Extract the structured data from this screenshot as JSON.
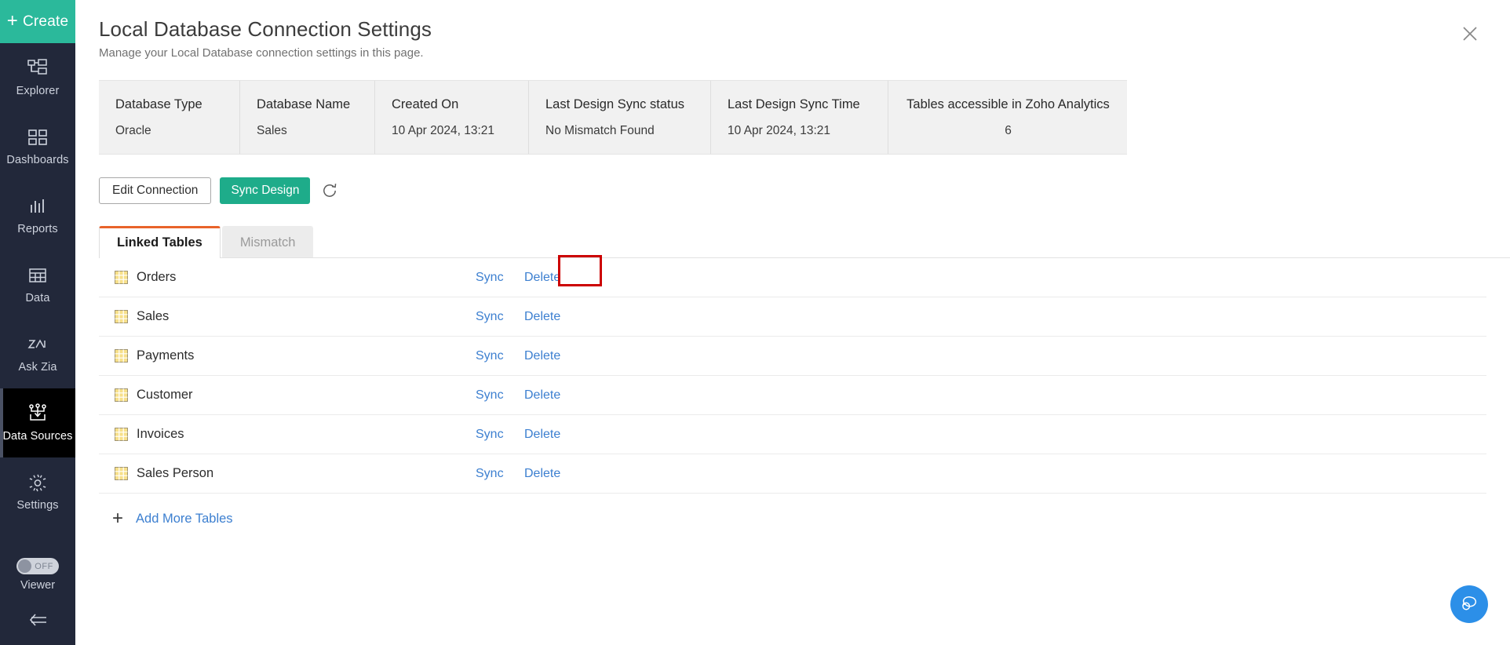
{
  "sidebar": {
    "create_label": "Create",
    "items": [
      {
        "label": "Explorer",
        "icon": "explorer-icon",
        "active": false
      },
      {
        "label": "Dashboards",
        "icon": "dashboards-icon",
        "active": false
      },
      {
        "label": "Reports",
        "icon": "reports-icon",
        "active": false
      },
      {
        "label": "Data",
        "icon": "data-icon",
        "active": false
      },
      {
        "label": "Ask Zia",
        "icon": "ask-zia-icon",
        "active": false
      },
      {
        "label": "Data Sources",
        "icon": "data-sources-icon",
        "active": true
      },
      {
        "label": "Settings",
        "icon": "settings-gear-icon",
        "active": false
      }
    ],
    "viewer": {
      "label": "Viewer",
      "toggle_state": "OFF"
    },
    "collapse_label": "collapse-sidebar"
  },
  "header": {
    "title": "Local Database Connection Settings",
    "subtitle": "Manage your Local Database connection settings in this page.",
    "close_label": "close-icon"
  },
  "info_table": {
    "columns": [
      {
        "header": "Database Type",
        "value": "Oracle"
      },
      {
        "header": "Database Name",
        "value": "Sales"
      },
      {
        "header": "Created On",
        "value": "10 Apr 2024, 13:21"
      },
      {
        "header": "Last Design Sync status",
        "value": "No Mismatch Found"
      },
      {
        "header": "Last Design Sync Time",
        "value": "10 Apr 2024, 13:21"
      },
      {
        "header": "Tables accessible in Zoho Analytics",
        "value": "6"
      }
    ]
  },
  "actions": {
    "edit_connection_label": "Edit Connection",
    "sync_design_label": "Sync Design",
    "refresh_label": "refresh-icon"
  },
  "tabs": [
    {
      "label": "Linked Tables",
      "active": true
    },
    {
      "label": "Mismatch",
      "active": false
    }
  ],
  "linked_tables": {
    "sync_label": "Sync",
    "delete_label": "Delete",
    "rows": [
      {
        "name": "Orders",
        "highlighted": true
      },
      {
        "name": "Sales",
        "highlighted": false
      },
      {
        "name": "Payments",
        "highlighted": false
      },
      {
        "name": "Customer",
        "highlighted": false
      },
      {
        "name": "Invoices",
        "highlighted": false
      },
      {
        "name": "Sales Person",
        "highlighted": false
      }
    ],
    "add_more_label": "Add More Tables"
  },
  "chat": {
    "label": "chat-support-icon"
  },
  "colors": {
    "sidebar_bg": "#22283a",
    "create_green": "#2bb99b",
    "sync_green": "#1eac8a",
    "tab_accent_orange": "#e8632a",
    "link_blue": "#3c7fd0",
    "highlight_red": "#cc0000",
    "chat_blue": "#2c8fe8",
    "grid_icon_gold": "#f5d76e"
  }
}
